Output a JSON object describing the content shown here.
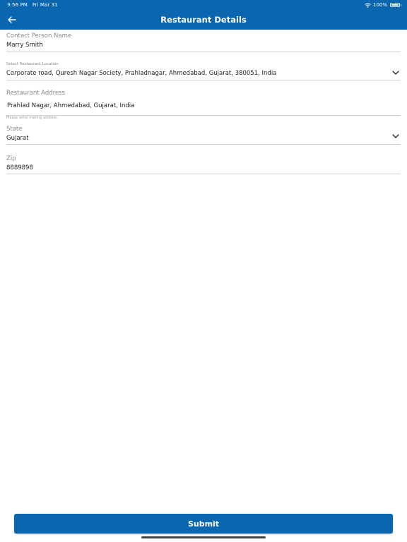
{
  "status_bar": {
    "time": "3:56 PM",
    "date": "Fri Mar 31",
    "battery": "100%"
  },
  "header": {
    "title": "Restaurant Details",
    "back_icon": "arrow-left-icon"
  },
  "form": {
    "contact": {
      "label": "Contact Person Name",
      "value": "Marry Smith"
    },
    "location": {
      "label": "Select Restaurant Location",
      "value": "Corporate road, Quresh Nagar Society, Prahladnagar, Ahmedabad, Gujarat, 380051, India",
      "icon": "chevron-down-icon"
    },
    "address": {
      "label": "Restaurant Address",
      "value": "Prahlad Nagar, Ahmedabad, Gujarat, India",
      "helper": "Please write mailing address"
    },
    "state": {
      "label": "State",
      "value": "Gujarat",
      "icon": "chevron-down-icon"
    },
    "zip": {
      "label": "Zip",
      "value": "8889898"
    }
  },
  "footer": {
    "submit_label": "Submit"
  },
  "colors": {
    "primary": "#0b66b0",
    "label": "#8a8a8a",
    "divider": "#d0d0d0"
  }
}
